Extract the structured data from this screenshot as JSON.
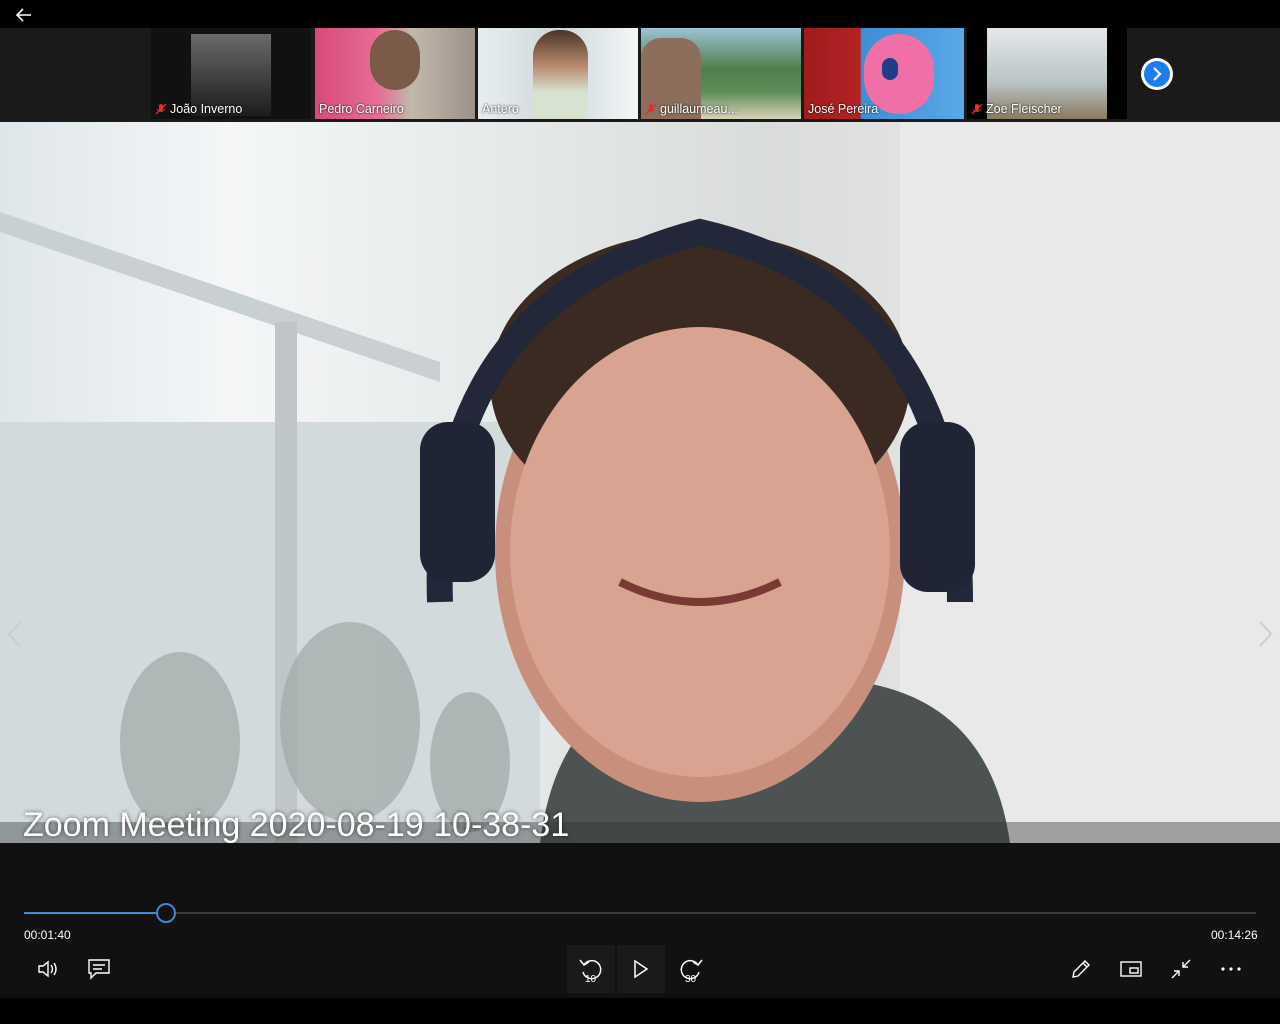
{
  "participants": [
    {
      "name": "João Inverno",
      "muted": true,
      "bg": "#2d2d2d"
    },
    {
      "name": "Pedro Carneiro",
      "muted": false,
      "bg": "#c9c4bb"
    },
    {
      "name": "Antero",
      "muted": false,
      "bg": "#cfd8dc"
    },
    {
      "name": "guillaumeau...",
      "muted": true,
      "bg": "#6fa0b8"
    },
    {
      "name": "José Pereira",
      "muted": false,
      "bg": "#3c8fd2"
    },
    {
      "name": "Zoe Fleischer",
      "muted": true,
      "bg": "#bfc7c9"
    }
  ],
  "video": {
    "title": "Zoom Meeting 2020-08-19 10-38-31"
  },
  "player": {
    "current_time": "00:01:40",
    "total_time": "00:14:26",
    "progress": 0.1155,
    "skip_back_label": "10",
    "skip_forward_label": "30"
  },
  "icons": {
    "back": "arrow-left-icon",
    "next": "chevron-right-icon",
    "volume": "speaker-icon",
    "captions": "captions-icon",
    "rewind": "rewind-10-icon",
    "play": "play-icon",
    "forward": "forward-30-icon",
    "edit": "pencil-icon",
    "mini": "mini-view-icon",
    "fullscreen": "exit-fullscreen-icon",
    "more": "more-icon"
  },
  "colors": {
    "accent": "#3a8ad6",
    "next_button": "#1a7ef0",
    "mute_red": "#e0302a"
  }
}
